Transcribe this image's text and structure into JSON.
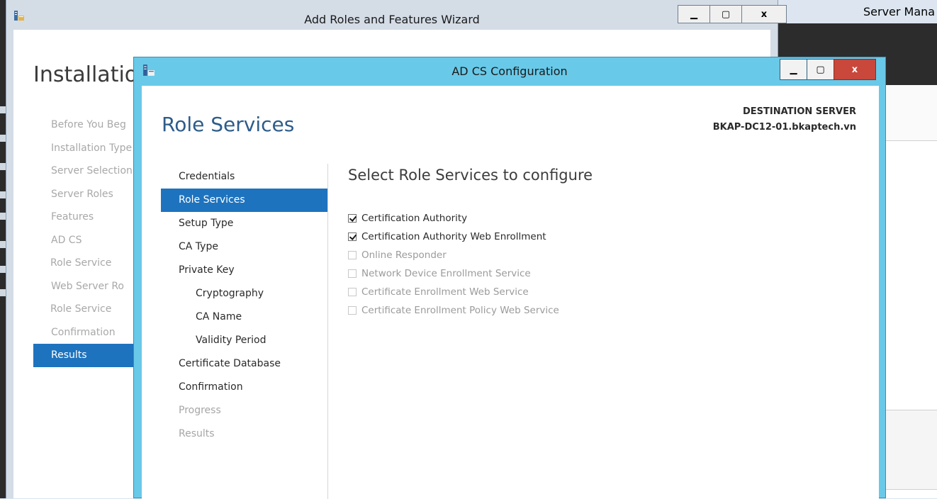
{
  "server_manager": {
    "title": "Server Mana"
  },
  "wizard": {
    "title": "Add Roles and Features Wizard",
    "heading": "Installation",
    "nav": [
      {
        "label": "Before You Beg",
        "sub": false,
        "active": false
      },
      {
        "label": "Installation Type",
        "sub": false,
        "active": false
      },
      {
        "label": "Server Selection",
        "sub": false,
        "active": false
      },
      {
        "label": "Server Roles",
        "sub": false,
        "active": false
      },
      {
        "label": "Features",
        "sub": false,
        "active": false
      },
      {
        "label": "AD CS",
        "sub": false,
        "active": false
      },
      {
        "label": "Role Service",
        "sub": true,
        "active": false
      },
      {
        "label": "Web Server Ro",
        "sub": false,
        "active": false
      },
      {
        "label": "Role Service",
        "sub": true,
        "active": false
      },
      {
        "label": "Confirmation",
        "sub": false,
        "active": false
      },
      {
        "label": "Results",
        "sub": false,
        "active": true
      }
    ],
    "buttons": {
      "minimize": "▁",
      "maximize": "▢",
      "close": "x"
    }
  },
  "dialog": {
    "title": "AD CS Configuration",
    "heading": "Role Services",
    "destination_label": "DESTINATION SERVER",
    "destination_server": "BKAP-DC12-01.bkaptech.vn",
    "buttons": {
      "minimize": "▁",
      "maximize": "▢",
      "close": "x"
    },
    "nav": [
      {
        "label": "Credentials",
        "state": "normal",
        "sub": false
      },
      {
        "label": "Role Services",
        "state": "active",
        "sub": false
      },
      {
        "label": "Setup Type",
        "state": "normal",
        "sub": false
      },
      {
        "label": "CA Type",
        "state": "normal",
        "sub": false
      },
      {
        "label": "Private Key",
        "state": "normal",
        "sub": false
      },
      {
        "label": "Cryptography",
        "state": "normal",
        "sub": true
      },
      {
        "label": "CA Name",
        "state": "normal",
        "sub": true
      },
      {
        "label": "Validity Period",
        "state": "normal",
        "sub": true
      },
      {
        "label": "Certificate Database",
        "state": "normal",
        "sub": false
      },
      {
        "label": "Confirmation",
        "state": "normal",
        "sub": false
      },
      {
        "label": "Progress",
        "state": "disabled",
        "sub": false
      },
      {
        "label": "Results",
        "state": "disabled",
        "sub": false
      }
    ],
    "content_heading": "Select Role Services to configure",
    "services": [
      {
        "label": "Certification Authority",
        "checked": true,
        "enabled": true
      },
      {
        "label": "Certification Authority Web Enrollment",
        "checked": true,
        "enabled": true
      },
      {
        "label": "Online Responder",
        "checked": false,
        "enabled": false
      },
      {
        "label": "Network Device Enrollment Service",
        "checked": false,
        "enabled": false
      },
      {
        "label": "Certificate Enrollment Web Service",
        "checked": false,
        "enabled": false
      },
      {
        "label": "Certificate Enrollment Policy Web Service",
        "checked": false,
        "enabled": false
      }
    ]
  },
  "colors": {
    "accent": "#1e73be",
    "dialog_frame": "#69c9e8",
    "close_red": "#c9473b"
  }
}
